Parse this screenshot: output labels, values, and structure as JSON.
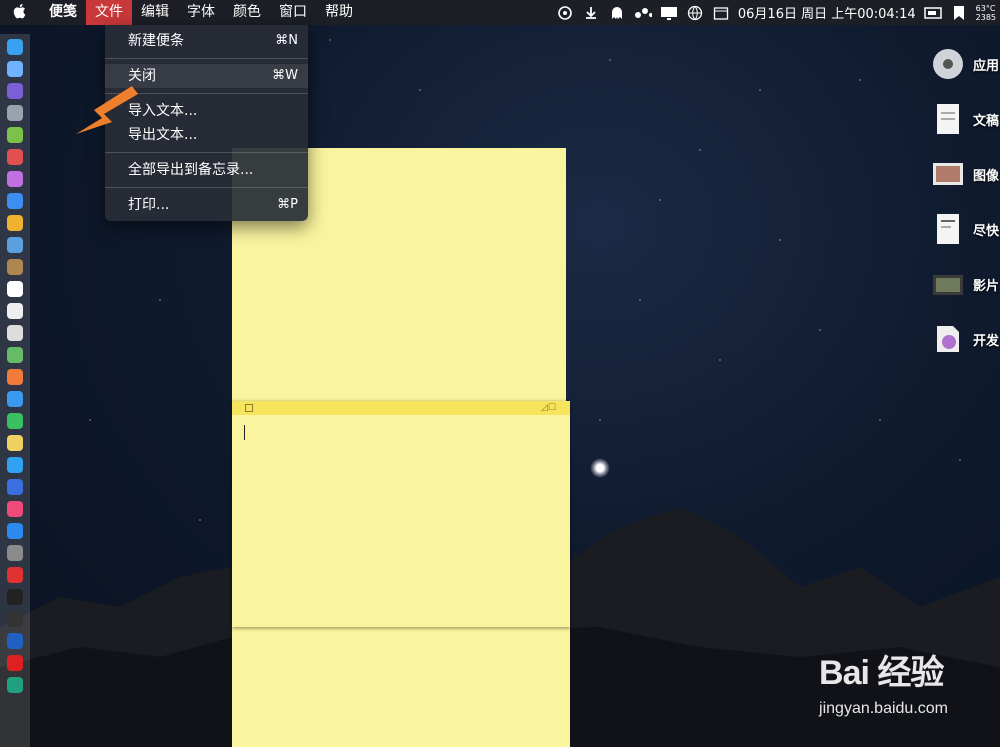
{
  "menubar": {
    "apple": "",
    "app_name": "便笺",
    "items": [
      "文件",
      "编辑",
      "字体",
      "颜色",
      "窗口",
      "帮助"
    ],
    "active_item": "文件",
    "clock": "06月16日 周日 上午00:04:14",
    "temp_top": "63°C",
    "temp_bottom": "2385"
  },
  "file_menu": {
    "items": [
      {
        "label": "新建便条",
        "shortcut": "⌘N"
      },
      {
        "label": "关闭",
        "shortcut": "⌘W"
      },
      {
        "label": "导入文本...",
        "shortcut": ""
      },
      {
        "label": "导出文本...",
        "shortcut": ""
      },
      {
        "label": "全部导出到备忘录...",
        "shortcut": ""
      },
      {
        "label": "打印...",
        "shortcut": "⌘P"
      }
    ]
  },
  "desktop_icons": [
    {
      "label": "应用",
      "icon": "app-icon"
    },
    {
      "label": "文稿",
      "icon": "document-icon"
    },
    {
      "label": "图像",
      "icon": "image-icon"
    },
    {
      "label": "尽快",
      "icon": "file-icon"
    },
    {
      "label": "影片",
      "icon": "movie-icon"
    },
    {
      "label": "开发",
      "icon": "dev-icon"
    }
  ],
  "watermark": {
    "brand": "Bai 经验",
    "site": "jingyan.baidu.com"
  },
  "colors": {
    "note_yellow": "#fbf49f",
    "note_bar": "#f6e55c",
    "active_menu": "#c9383a",
    "arrow": "#f07f2c"
  }
}
